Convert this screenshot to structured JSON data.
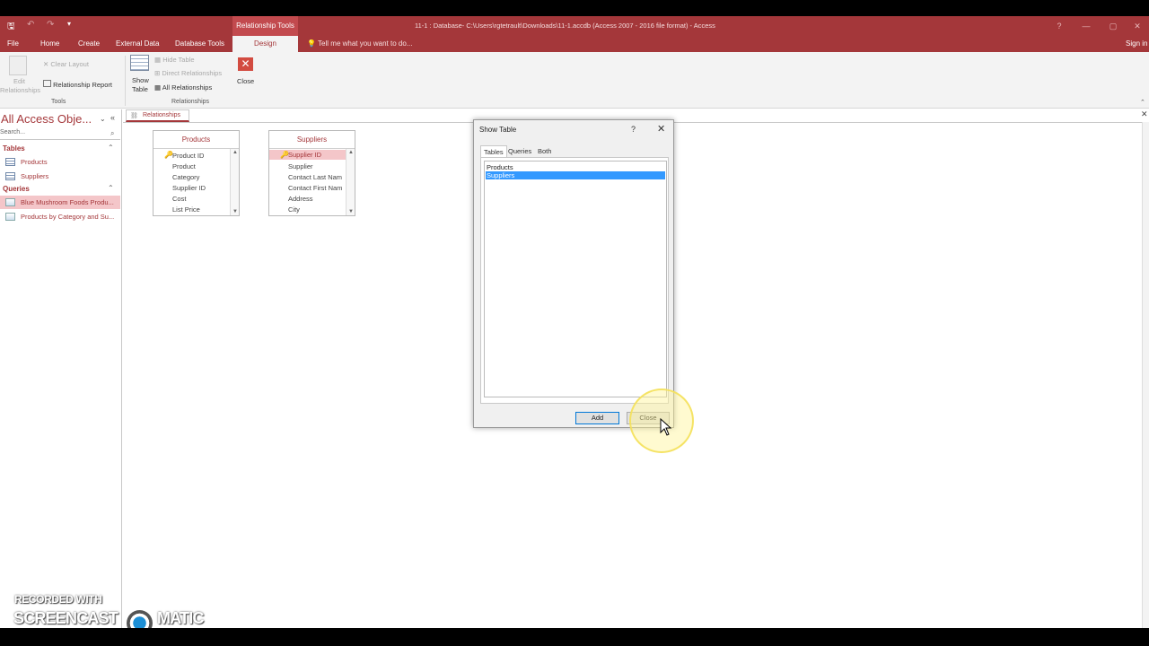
{
  "window": {
    "context_group": "Relationship Tools",
    "doc_title": "11-1 : Database- C:\\Users\\rgtetrault\\Downloads\\11-1.accdb (Access 2007 - 2016 file format) - Access",
    "sign_in": "Sign in",
    "min_glyph": "—",
    "restore_glyph": "▢",
    "close_glyph": "✕",
    "help_glyph": "?"
  },
  "tabs": {
    "file": "File",
    "home": "Home",
    "create": "Create",
    "external": "External Data",
    "dbtools": "Database Tools",
    "design": "Design",
    "tellme": "Tell me what you want to do..."
  },
  "ribbon": {
    "edit_rel_1": "Edit",
    "edit_rel_2": "Relationships",
    "clear_layout": "Clear Layout",
    "rel_report": "Relationship Report",
    "tools_group": "Tools",
    "show_table_1": "Show",
    "show_table_2": "Table",
    "hide_table": "Hide Table",
    "direct_rel": "Direct Relationships",
    "all_rel": "All Relationships",
    "rel_group": "Relationships",
    "close": "Close"
  },
  "nav": {
    "title": "All Access Obje...",
    "search_placeholder": "Search...",
    "tables_head": "Tables",
    "queries_head": "Queries",
    "tables": [
      "Products",
      "Suppliers"
    ],
    "queries": [
      "Blue Mushroom Foods Produ...",
      "Products by Category and Su..."
    ]
  },
  "document": {
    "tab_label": "Relationships"
  },
  "products_table": {
    "title": "Products",
    "fields": [
      "Product ID",
      "Product",
      "Category",
      "Supplier ID",
      "Cost",
      "List Price"
    ]
  },
  "suppliers_table": {
    "title": "Suppliers",
    "fields": [
      "Supplier ID",
      "Supplier",
      "Contact Last Nam",
      "Contact First Nam",
      "Address",
      "City"
    ]
  },
  "dialog": {
    "title": "Show Table",
    "help": "?",
    "close_x": "✕",
    "tabs": [
      "Tables",
      "Queries",
      "Both"
    ],
    "list": [
      "Products",
      "Suppliers"
    ],
    "selected": "Suppliers",
    "add_button": "Add",
    "close_button": "Close"
  },
  "watermark": {
    "line1": "RECORDED WITH",
    "line2a": "SCREENCAST",
    "line2b": "MATIC"
  },
  "colors": {
    "access_red": "#a4373a",
    "selection_pink": "#f4c6c9",
    "list_selection": "#3399ff"
  }
}
